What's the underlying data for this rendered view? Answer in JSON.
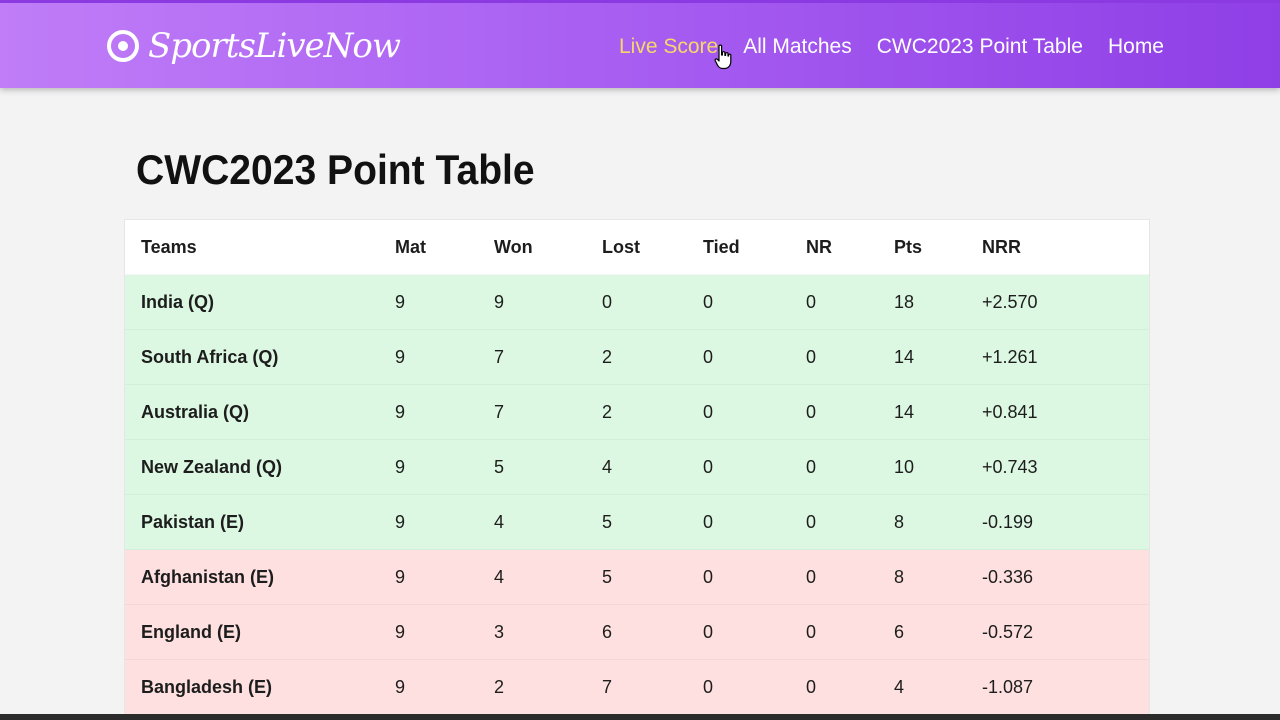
{
  "brand": {
    "name": "SportsLiveNow",
    "icon": "target-icon"
  },
  "nav": {
    "items": [
      {
        "label": "Live Score",
        "active": true
      },
      {
        "label": "All Matches",
        "active": false
      },
      {
        "label": "CWC2023 Point Table",
        "active": false
      },
      {
        "label": "Home",
        "active": false
      }
    ]
  },
  "colors": {
    "navbar_start": "#c07df7",
    "navbar_end": "#8f3fe6",
    "active_link": "#f6d76a",
    "qualified_row": "#dcf8e2",
    "eliminated_row": "#fde0df"
  },
  "main": {
    "title": "CWC2023 Point Table"
  },
  "table": {
    "headers": [
      "Teams",
      "Mat",
      "Won",
      "Lost",
      "Tied",
      "NR",
      "Pts",
      "NRR"
    ],
    "rows": [
      {
        "team": "India (Q)",
        "mat": "9",
        "won": "9",
        "lost": "0",
        "tied": "0",
        "nr": "0",
        "pts": "18",
        "nrr": "+2.570",
        "status": "green"
      },
      {
        "team": "South Africa (Q)",
        "mat": "9",
        "won": "7",
        "lost": "2",
        "tied": "0",
        "nr": "0",
        "pts": "14",
        "nrr": "+1.261",
        "status": "green"
      },
      {
        "team": "Australia (Q)",
        "mat": "9",
        "won": "7",
        "lost": "2",
        "tied": "0",
        "nr": "0",
        "pts": "14",
        "nrr": "+0.841",
        "status": "green"
      },
      {
        "team": "New Zealand (Q)",
        "mat": "9",
        "won": "5",
        "lost": "4",
        "tied": "0",
        "nr": "0",
        "pts": "10",
        "nrr": "+0.743",
        "status": "green"
      },
      {
        "team": "Pakistan (E)",
        "mat": "9",
        "won": "4",
        "lost": "5",
        "tied": "0",
        "nr": "0",
        "pts": "8",
        "nrr": "-0.199",
        "status": "green"
      },
      {
        "team": "Afghanistan (E)",
        "mat": "9",
        "won": "4",
        "lost": "5",
        "tied": "0",
        "nr": "0",
        "pts": "8",
        "nrr": "-0.336",
        "status": "red"
      },
      {
        "team": "England (E)",
        "mat": "9",
        "won": "3",
        "lost": "6",
        "tied": "0",
        "nr": "0",
        "pts": "6",
        "nrr": "-0.572",
        "status": "red"
      },
      {
        "team": "Bangladesh (E)",
        "mat": "9",
        "won": "2",
        "lost": "7",
        "tied": "0",
        "nr": "0",
        "pts": "4",
        "nrr": "-1.087",
        "status": "red"
      }
    ]
  }
}
